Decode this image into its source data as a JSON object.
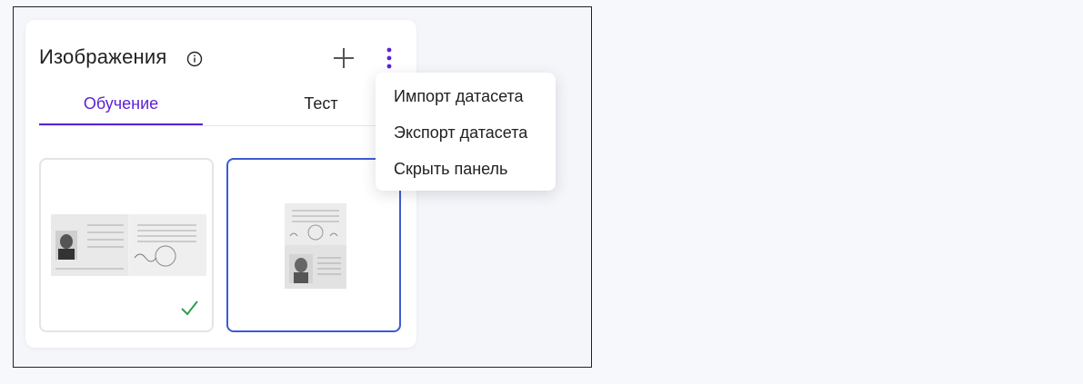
{
  "panel": {
    "title": "Изображения",
    "tabs": [
      {
        "label": "Обучение",
        "active": true
      },
      {
        "label": "Тест",
        "active": false
      }
    ]
  },
  "images": [
    {
      "name": "passport-spread-horizontal",
      "checked": true
    },
    {
      "name": "passport-spread-vertical",
      "checked": false,
      "selected": true
    }
  ],
  "menu": {
    "items": [
      {
        "label": "Импорт датасета"
      },
      {
        "label": "Экспорт датасета"
      },
      {
        "label": "Скрыть панель"
      }
    ]
  },
  "colors": {
    "accent": "#5b22d4",
    "selected_border": "#3d5bd1",
    "check": "#2e9e4f"
  }
}
